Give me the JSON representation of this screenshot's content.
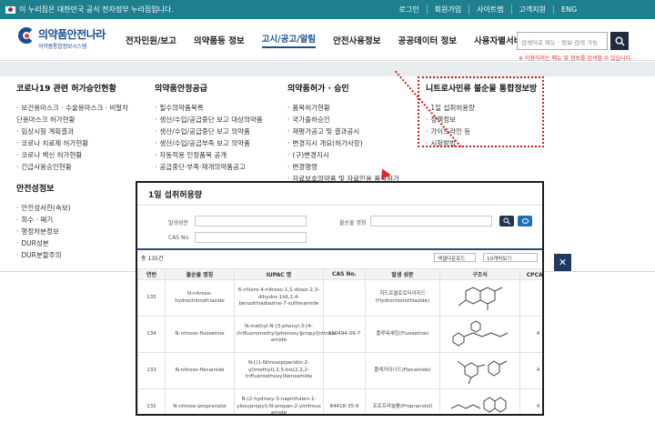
{
  "govbar": {
    "notice": "이 누리집은 대한민국 공식 전자정부 누리집입니다.",
    "links": [
      "로그인",
      "회원가입",
      "사이트맵",
      "고객지원"
    ],
    "lang": "ENG"
  },
  "header": {
    "logo_title": "의약품안전나라",
    "logo_sub": "의약품통합정보시스템",
    "nav": [
      "전자민원/보고",
      "의약품등 정보",
      "고시/공고/알림",
      "안전사용정보",
      "공공데이터 정보",
      "사용자별서비스"
    ],
    "active_index": 2,
    "search_placeholder": "검색어로 메뉴 · 정보 검색 가능",
    "search_note": "※ 이용하려는 메뉴 및 정보를 검색할 수 있습니다."
  },
  "menu": {
    "col1": {
      "title": "코로나19 관련 허가승인현황",
      "items": [
        "보건용마스크 · 수술용마스크 · 비말차단용마스크 허가현황",
        "임상시험 계획결과",
        "코로나 치료제 허가현황",
        "코로나 백신 허가현황",
        "긴급사용승인현황"
      ],
      "sub_title": "안전성정보",
      "sub_items": [
        "안전성서한(속보)",
        "회수 · 폐기",
        "행정처분정보",
        "DUR성분",
        "DUR분할주의"
      ]
    },
    "col2": {
      "title": "의약품안정공급",
      "items": [
        "필수의약품목록",
        "생산/수입/공급중단 보고 대상의약품",
        "생산/수입/공급중단 보고 의약품",
        "생산/수입/공급부족 보고 의약품",
        "자동적용 인정품목 공개",
        "공급중단·부족·재개의약품공고"
      ]
    },
    "col3": {
      "title": "의약품허가 · 승인",
      "items": [
        "품목허가현황",
        "국가출하승인",
        "재평가공고 및 결과공시",
        "변경지시 개요(허가사항)",
        "(구)변경지시",
        "변경명령",
        "자료보호의약품 및 자료인용 품목허가"
      ]
    },
    "col4": {
      "title": "니트로사민류 불순물 통합정보방",
      "items": [
        "1일 섭취허용량",
        "정책정보",
        "가이드라인 등",
        "시험방법"
      ]
    }
  },
  "popup": {
    "title": "1일 섭취허용량",
    "filter_labels": [
      "발생성분",
      "불순물 명칭",
      "CAS No."
    ],
    "count": "총 135건",
    "excel": "엑셀다운로드",
    "per_page": "10개씩보기",
    "columns": [
      "연번",
      "불순물 명칭",
      "IUPAC 명",
      "CAS No.",
      "발생 성분",
      "구조식",
      "CPCA 등"
    ],
    "rows": [
      {
        "no": "135",
        "name": "N-nitroso-hydrochlorothiazide",
        "iupac": "6-chloro-4-nitroso-1,1-dioxo-2,3-dihydro-1λ6,2,4-benzothiadiazine-7-sulfonamide",
        "cas": "",
        "source": "히드로클로로티아지드(Hydrochlorothiazide)",
        "cpca": ""
      },
      {
        "no": "134",
        "name": "N-nitroso-fluoxetine",
        "iupac": "N-methyl-N-[3-phenyl-3-[4-(trifluoromethyl)phenoxy]propyl]nitrous amide",
        "cas": "150494-06-7",
        "source": "플루옥세틴(Fluoxetine)",
        "cpca": "4"
      },
      {
        "no": "133",
        "name": "N-nitroso-flecainide",
        "iupac": "N-[(1-Nitrosopiperidin-2-yl)methyl]-2,5-bis(2,2,2-trifluoroethoxy)benzamide",
        "cas": "",
        "source": "플레카이니드(Flecainide)",
        "cpca": "4"
      },
      {
        "no": "132",
        "name": "N-nitroso-propranolol",
        "iupac": "N-(2-hydroxy-3-naphthalen-1-yloxypropyl)-N-propan-2-ylnitrous amide",
        "cas": "84418-35-9",
        "source": "프로프라놀롤(Propranolol)",
        "cpca": "4"
      }
    ]
  },
  "icons": {
    "search": "search-icon",
    "close": "close-icon"
  },
  "colors": {
    "govbar": "#1e7f8e",
    "brand": "#1a4f91",
    "highlight": "#cc1f1f"
  }
}
